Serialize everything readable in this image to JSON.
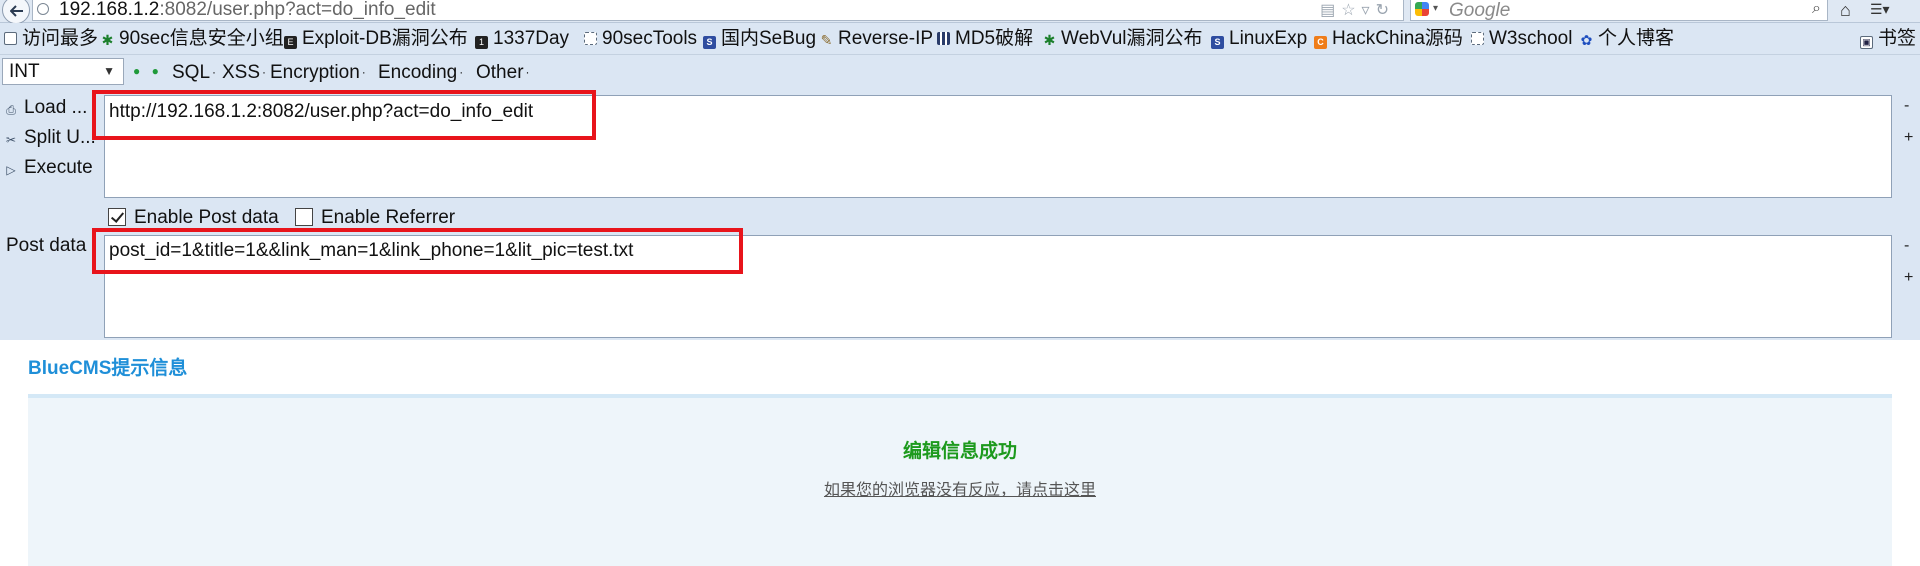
{
  "browser": {
    "url_host": "192.168.1.2",
    "url_rest": ":8082/user.php?act=do_info_edit",
    "search_engine": "Google"
  },
  "bookmarks": [
    {
      "label": "访问最多",
      "icon": "page-icon"
    },
    {
      "label": "90sec信息安全小组",
      "icon": "star-icon"
    },
    {
      "label": "Exploit-DB漏洞公布",
      "icon": "exploit-db-icon"
    },
    {
      "label": "1337Day",
      "icon": "1337day-icon"
    },
    {
      "label": "90secTools",
      "icon": "page-icon"
    },
    {
      "label": "国内SeBug",
      "icon": "sebug-icon"
    },
    {
      "label": "Reverse-IP",
      "icon": "pen-icon"
    },
    {
      "label": "MD5破解",
      "icon": "grid-icon"
    },
    {
      "label": "WebVul漏洞公布",
      "icon": "star-icon"
    },
    {
      "label": "LinuxExp",
      "icon": "sebug-icon"
    },
    {
      "label": "HackChina源码",
      "icon": "hackchina-icon"
    },
    {
      "label": "W3school",
      "icon": "page-icon"
    },
    {
      "label": "个人博客",
      "icon": "paw-icon"
    },
    {
      "label": "书签",
      "icon": "bookmarks-icon"
    }
  ],
  "hackbar": {
    "select_value": "INT",
    "menus": [
      "SQL",
      "XSS",
      "Encryption",
      "Encoding",
      "Other"
    ],
    "actions": [
      "Load ...",
      "Split U...",
      "Execute"
    ],
    "url_value": "http://192.168.1.2:8082/user.php?act=do_info_edit",
    "enable_post_label": "Enable Post data",
    "enable_post_checked": true,
    "enable_referrer_label": "Enable Referrer",
    "enable_referrer_checked": false,
    "post_label": "Post data",
    "post_value": "post_id=1&title=1&&link_man=1&link_phone=1&lit_pic=test.txt",
    "minus": "-",
    "plus": "+"
  },
  "page": {
    "cms_title": "BlueCMS提示信息",
    "message": "编辑信息成功",
    "redirect_link": "如果您的浏览器没有反应，请点击这里"
  },
  "colors": {
    "highlight": "#e8141b",
    "cms_title": "#1f8fd8",
    "success": "#1d9a1d"
  }
}
